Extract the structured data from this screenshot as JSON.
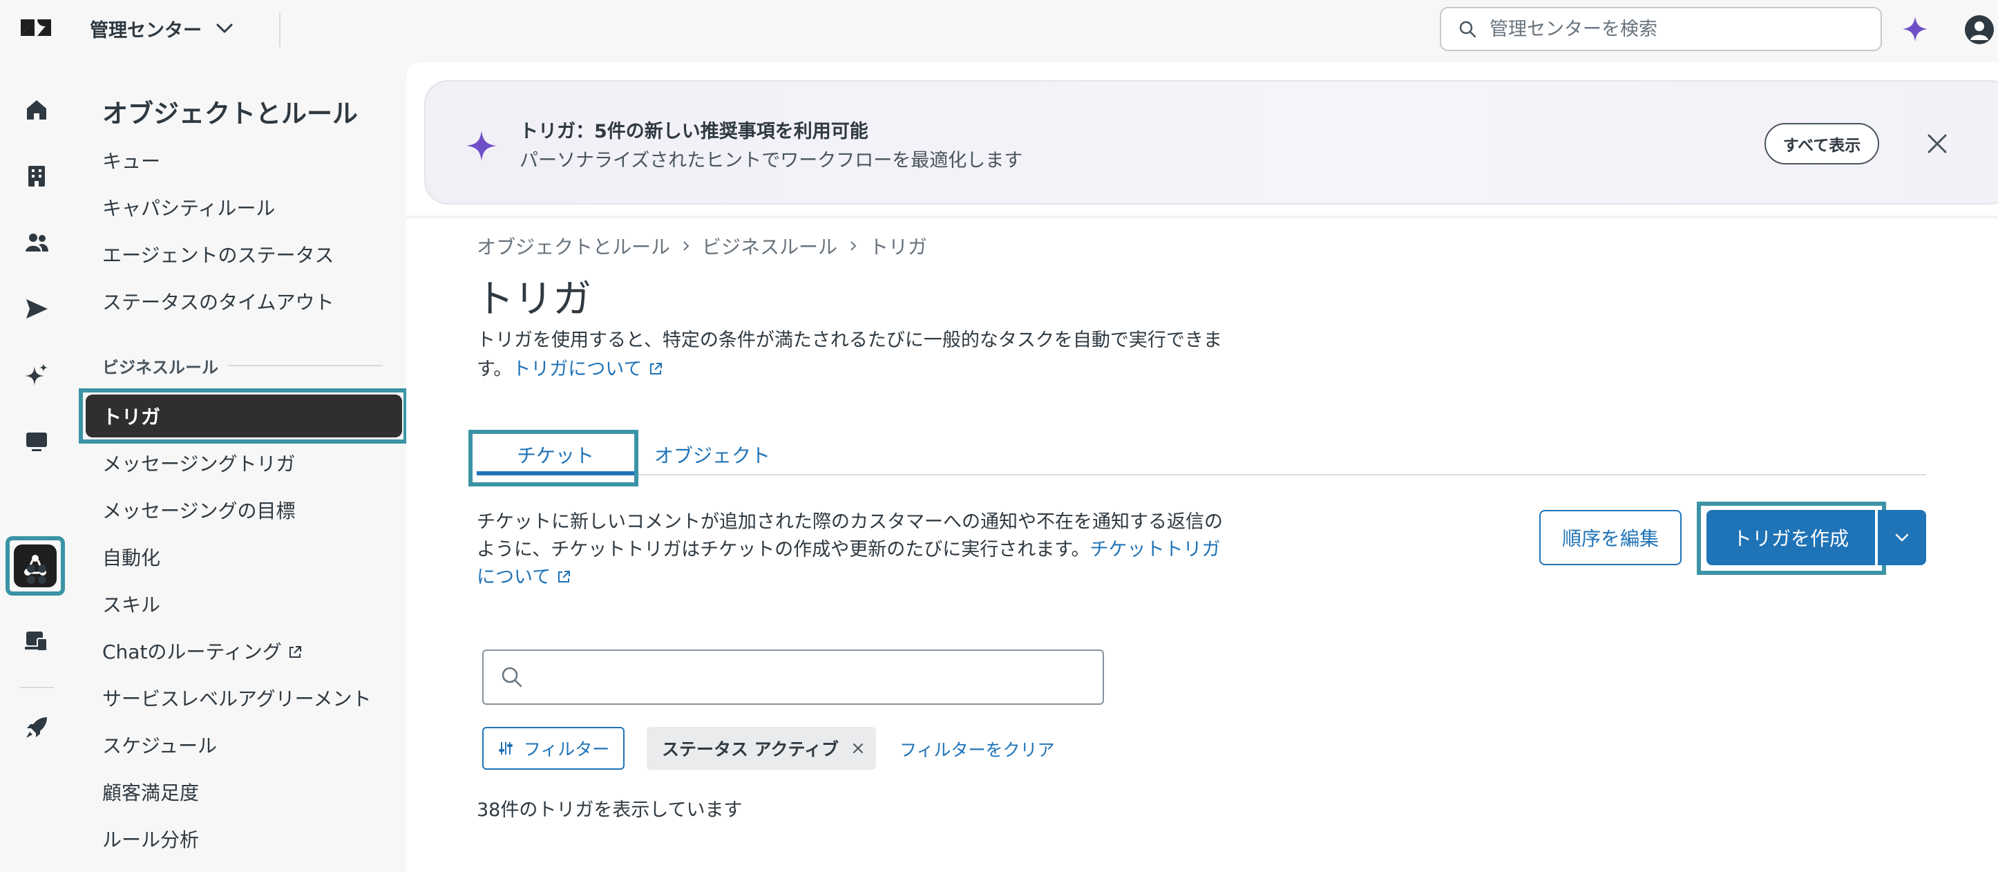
{
  "colors": {
    "accent": "#1f73b7",
    "highlight": "#3b94a6",
    "ai_purple": "#6e4fc8",
    "selected_nav": "#2f2f2f",
    "text": "#2f3941"
  },
  "topbar": {
    "product_name": "管理センター",
    "search_placeholder": "管理センターを検索",
    "icons": [
      "zendesk-logo",
      "chevron-down-icon",
      "search-icon",
      "ai-sparkle-icon",
      "user-avatar-icon"
    ]
  },
  "rail": {
    "icons": [
      "home-icon",
      "building-icon",
      "people-icon",
      "send-icon",
      "sparkle-icon",
      "monitor-icon",
      "objects-rules-icon",
      "apps-icon",
      "workspace-icon",
      "rocket-icon"
    ],
    "active": "objects-rules-icon"
  },
  "nav": {
    "title": "オブジェクトとルール",
    "items_top": [
      "キュー",
      "キャパシティルール",
      "エージェントのステータス",
      "ステータスのタイムアウト"
    ],
    "section_business": "ビジネスルール",
    "selected": "トリガ",
    "items_business": [
      "メッセージングトリガ",
      "メッセージングの目標",
      "自動化",
      "スキル",
      "Chatのルーティング",
      "サービスレベルアグリーメント",
      "スケジュール",
      "顧客満足度",
      "ルール分析"
    ]
  },
  "banner": {
    "title": "トリガ：5件の新しい推奨事項を利用可能",
    "subtitle": "パーソナライズされたヒントでワークフローを最適化します",
    "show_all": "すべて表示"
  },
  "breadcrumb": [
    "オブジェクトとルール",
    "ビジネスルール",
    "トリガ"
  ],
  "page": {
    "title": "トリガ",
    "description": "トリガを使用すると、特定の条件が満たされるたびに一般的なタスクを自動で実行できます。",
    "description_link": "トリガについて"
  },
  "tabs": [
    {
      "label": "チケット",
      "active": true
    },
    {
      "label": "オブジェクト",
      "active": false
    }
  ],
  "tab_content": {
    "description": "チケットに新しいコメントが追加された際のカスタマーへの通知や不在を通知する返信のように、チケットトリガはチケットの作成や更新のたびに実行されます。",
    "description_link": "チケットトリガについて",
    "edit_order": "順序を編集",
    "create_trigger": "トリガを作成",
    "search_value": "",
    "filter_button": "フィルター",
    "active_filter": "ステータス アクティブ",
    "clear_filters": "フィルターをクリア",
    "count_text": "38件のトリガを表示しています"
  }
}
